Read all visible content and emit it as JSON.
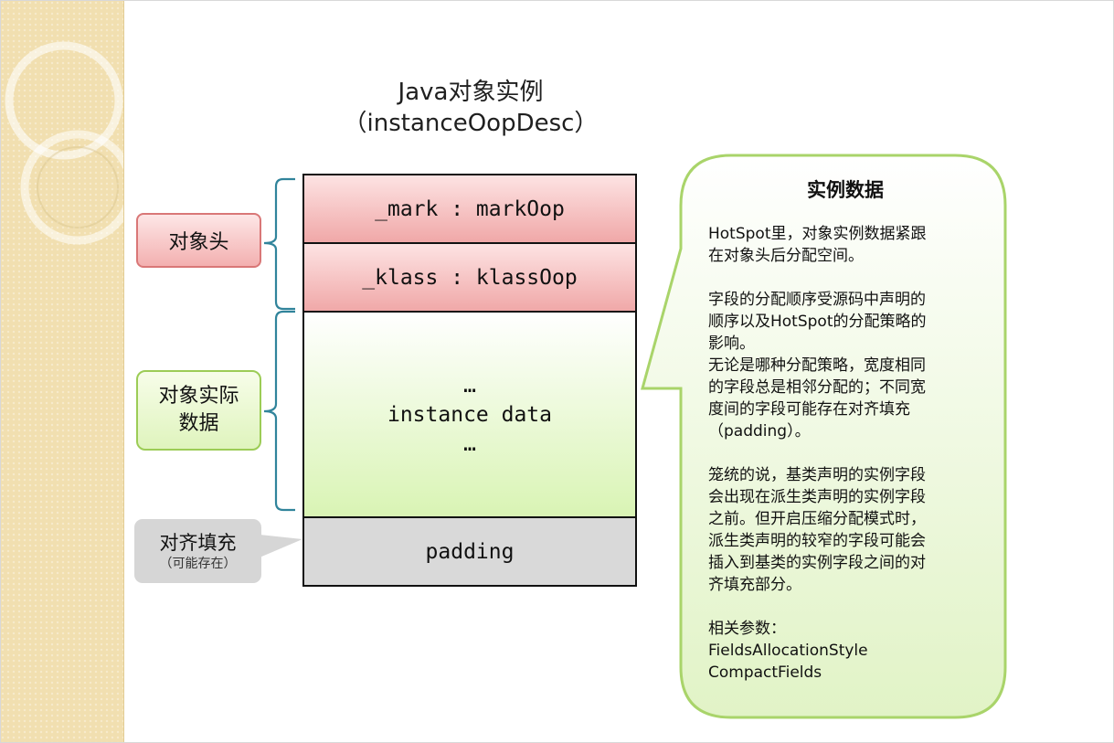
{
  "title": {
    "line1": "Java对象实例",
    "line2": "（instanceOopDesc）"
  },
  "stack": {
    "mark": "_mark : markOop",
    "klass": "_klass : klassOop",
    "instance_ellipsis_top": "…",
    "instance": "instance data",
    "instance_ellipsis_bottom": "…",
    "padding": "padding"
  },
  "labels": {
    "header": "对象头",
    "data": "对象实际\n数据",
    "padding_main": "对齐填充",
    "padding_sub": "（可能存在）"
  },
  "callout": {
    "title": "实例数据",
    "body": "HotSpot里，对象实例数据紧跟\n在对象头后分配空间。\n\n字段的分配顺序受源码中声明的\n顺序以及HotSpot的分配策略的\n影响。\n无论是哪种分配策略，宽度相同\n的字段总是相邻分配的；不同宽\n度间的字段可能存在对齐填充\n（padding）。\n\n笼统的说，基类声明的实例字段\n会出现在派生类声明的实例字段\n之前。但开启压缩分配模式时，\n派生类声明的较窄的字段可能会\n插入到基类的实例字段之间的对\n齐填充部分。\n\n相关参数：\nFieldsAllocationStyle\nCompactFields"
  },
  "colors": {
    "header_fill": "#f3b0b0",
    "data_fill": "#dff4bd",
    "padding_fill": "#d9d9d9",
    "brace": "#31849b",
    "callout_border": "#a9d46a"
  }
}
